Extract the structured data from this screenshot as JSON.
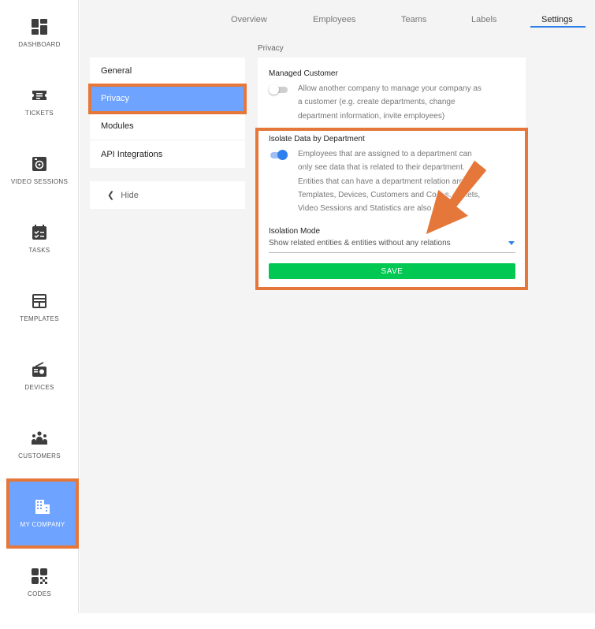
{
  "sidebar": {
    "items": [
      {
        "label": "DASHBOARD",
        "icon": "dashboard-icon"
      },
      {
        "label": "TICKETS",
        "icon": "tickets-icon"
      },
      {
        "label": "VIDEO SESSIONS",
        "icon": "video-sessions-icon"
      },
      {
        "label": "TASKS",
        "icon": "tasks-icon"
      },
      {
        "label": "TEMPLATES",
        "icon": "templates-icon"
      },
      {
        "label": "DEVICES",
        "icon": "devices-icon"
      },
      {
        "label": "CUSTOMERS",
        "icon": "customers-icon"
      },
      {
        "label": "MY COMPANY",
        "icon": "my-company-icon",
        "active": true
      },
      {
        "label": "CODES",
        "icon": "codes-icon"
      }
    ]
  },
  "topnav": {
    "tabs": [
      "Overview",
      "Employees",
      "Teams",
      "Labels",
      "Settings"
    ],
    "active": "Settings"
  },
  "settings_menu": {
    "items": [
      "General",
      "Privacy",
      "Modules",
      "API Integrations"
    ],
    "active": "Privacy",
    "hide_label": "Hide"
  },
  "privacy": {
    "section_title": "Privacy",
    "managed_customer": {
      "title": "Managed Customer",
      "lines": [
        "Allow another company to manage your company as",
        "a customer (e.g. create departments, change",
        "department information, invite employees)"
      ],
      "enabled": false
    },
    "isolate_data": {
      "title": "Isolate Data by Department",
      "lines": [
        "Employees that are assigned to a department can",
        "only see data that is related to their department.",
        "Entities that can have a department relation are",
        "Templates, Devices, Customers and Codes. Tickets,",
        "Video Sessions and Statistics are also filtered."
      ],
      "enabled": true
    },
    "isolation_mode": {
      "label": "Isolation Mode",
      "value": "Show related entities & entities without any relations"
    },
    "save_label": "SAVE"
  },
  "colors": {
    "accent": "#2f80ed",
    "active_bg": "#6ea3ff",
    "highlight": "#e5773a",
    "save": "#00c853"
  }
}
